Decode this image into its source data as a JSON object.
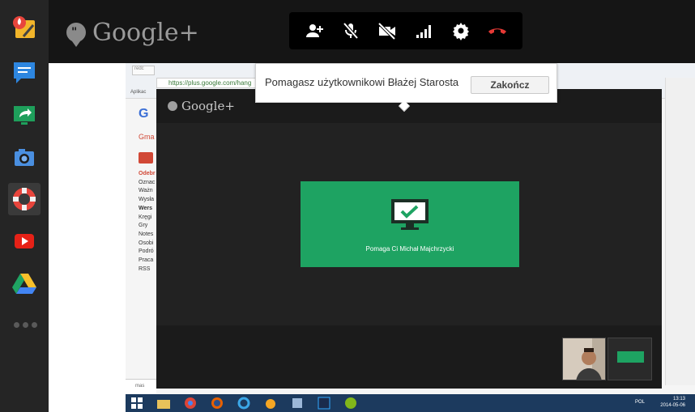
{
  "topbar": {
    "brand": "Google+",
    "controls": [
      {
        "name": "invite-people-icon",
        "color": "#ffffff"
      },
      {
        "name": "mic-muted-icon",
        "color": "#ffffff"
      },
      {
        "name": "camera-off-icon",
        "color": "#ffffff"
      },
      {
        "name": "bandwidth-signal-icon",
        "color": "#ffffff"
      },
      {
        "name": "gear-icon",
        "color": "#ffffff"
      },
      {
        "name": "hang-up-icon",
        "color": "#e53935"
      }
    ]
  },
  "sidebar": {
    "apps": [
      {
        "name": "effects-app-icon"
      },
      {
        "name": "chat-app-icon"
      },
      {
        "name": "screenshare-app-icon"
      },
      {
        "name": "capture-app-icon"
      },
      {
        "name": "remote-desktop-app-icon",
        "active": true
      },
      {
        "name": "youtube-app-icon"
      },
      {
        "name": "drive-app-icon"
      }
    ]
  },
  "shared_screen": {
    "tab_title": "redc",
    "url": "https://plus.google.com/hang",
    "bookmarks_label": "Aplikac",
    "gmail_logo": "G",
    "gmail_label": "Gma",
    "gmail_folders": [
      "Odebr",
      "Oznac",
      "Ważn",
      "Wysła",
      "Wers",
      "Kręgi",
      "Gry",
      "Notes",
      "Osobi",
      "Podró",
      "Praca",
      "RSS"
    ],
    "status_text": "mas",
    "taskbar": {
      "lang": "POL",
      "time": "13:13",
      "date": "2014-05-06"
    },
    "hangout": {
      "brand": "Google+",
      "helper_text": "Pomaga Ci Michał Majchrzycki"
    }
  },
  "banner": {
    "message": "Pomagasz użytkownikowi Błażej Starosta",
    "end_button": "Zakończ"
  },
  "colors": {
    "accent_green": "#1ea362",
    "hangup_red": "#e53935",
    "topbar_bg": "#151515"
  }
}
